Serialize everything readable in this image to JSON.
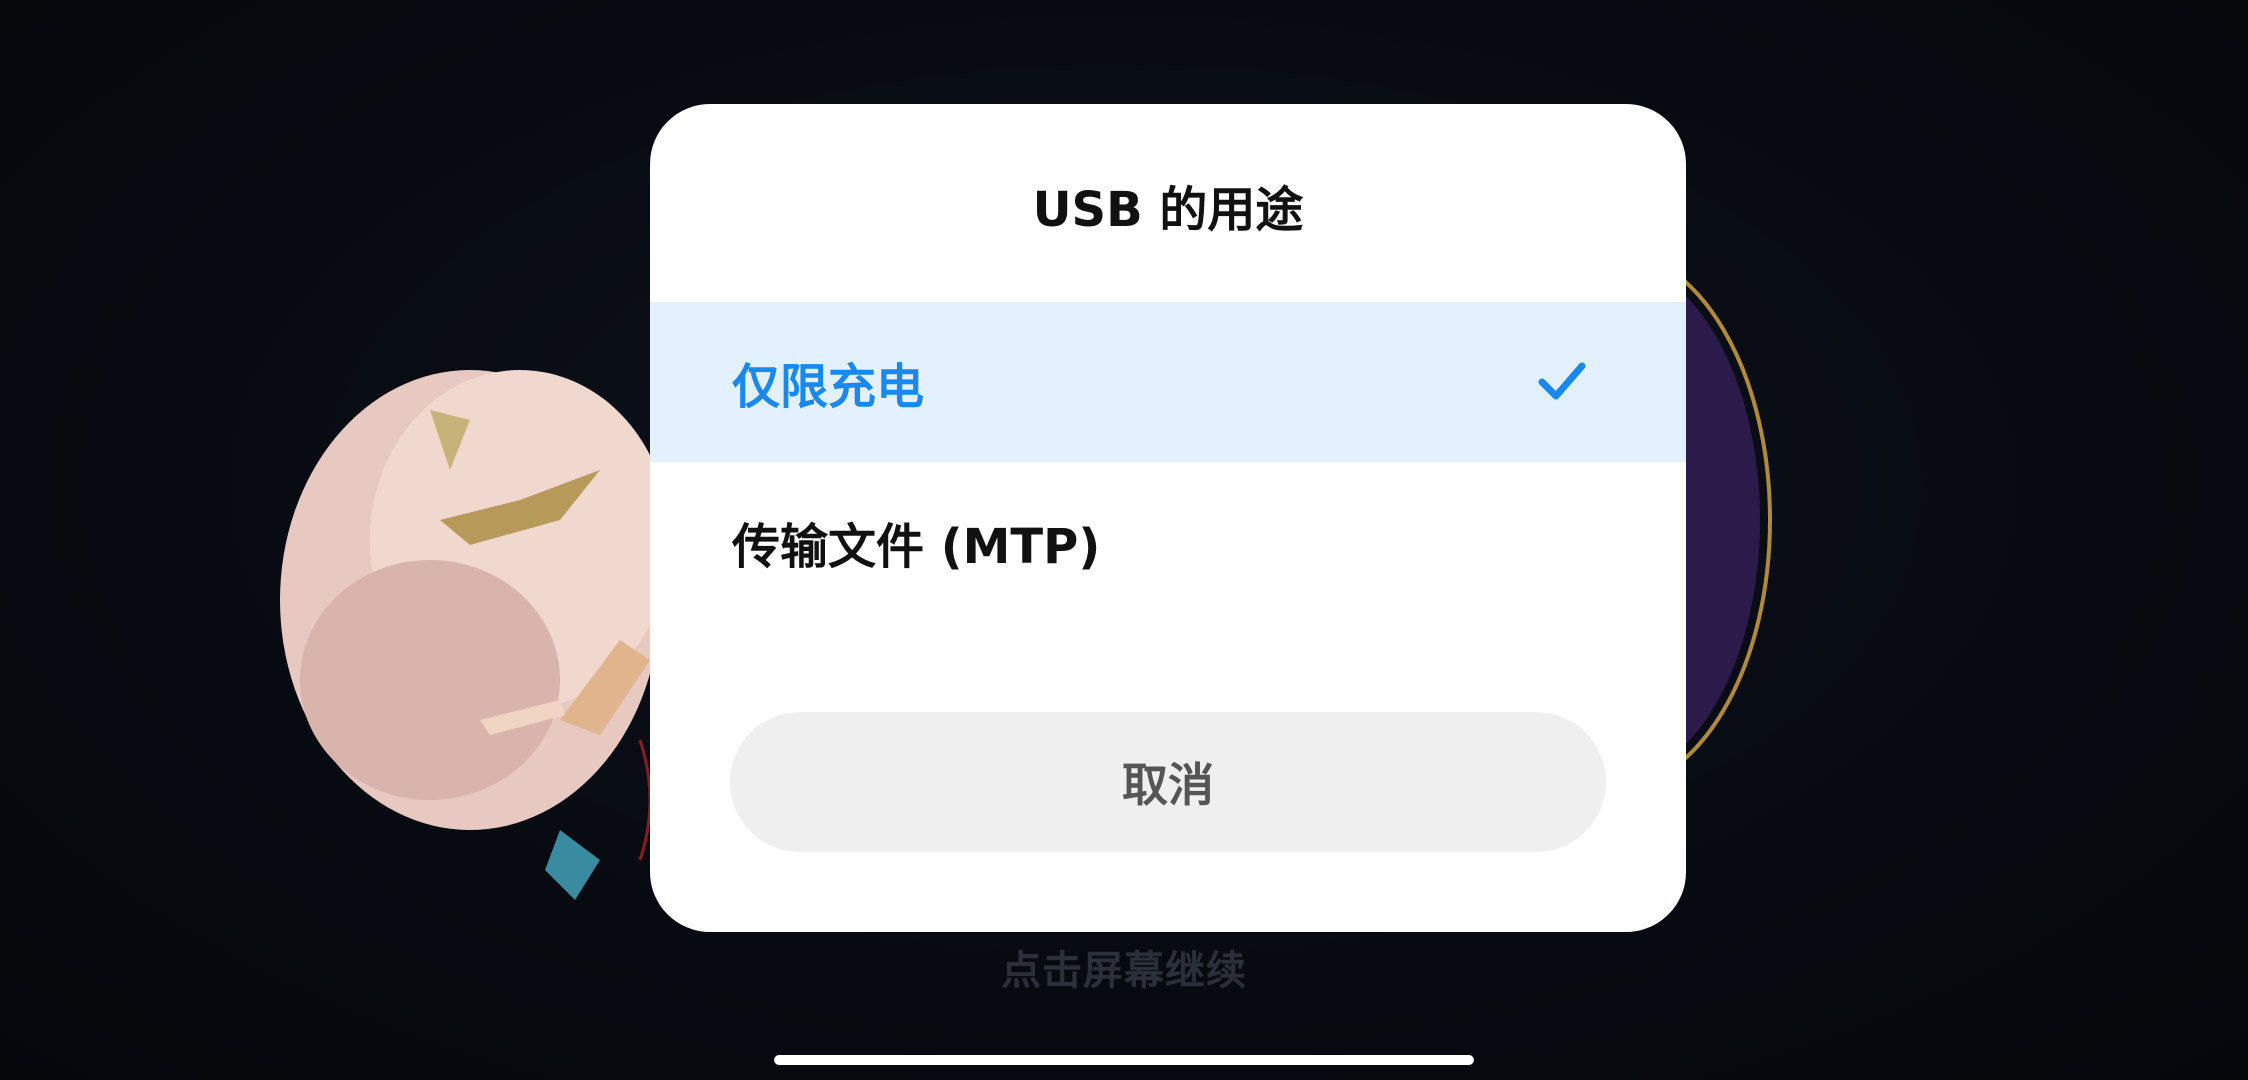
{
  "background": {
    "tap_hint": "点击屏幕继续"
  },
  "dialog": {
    "title": "USB 的用途",
    "options": [
      {
        "label": "仅限充电",
        "selected": true,
        "icon": "check-icon"
      },
      {
        "label": "传输文件 (MTP)",
        "selected": false
      }
    ],
    "cancel_label": "取消"
  },
  "colors": {
    "accent": "#1989f0",
    "selected_bg": "#e3f0fd",
    "dialog_bg": "#ffffff",
    "cancel_bg": "#efefef",
    "screen_bg": "#070a10"
  }
}
